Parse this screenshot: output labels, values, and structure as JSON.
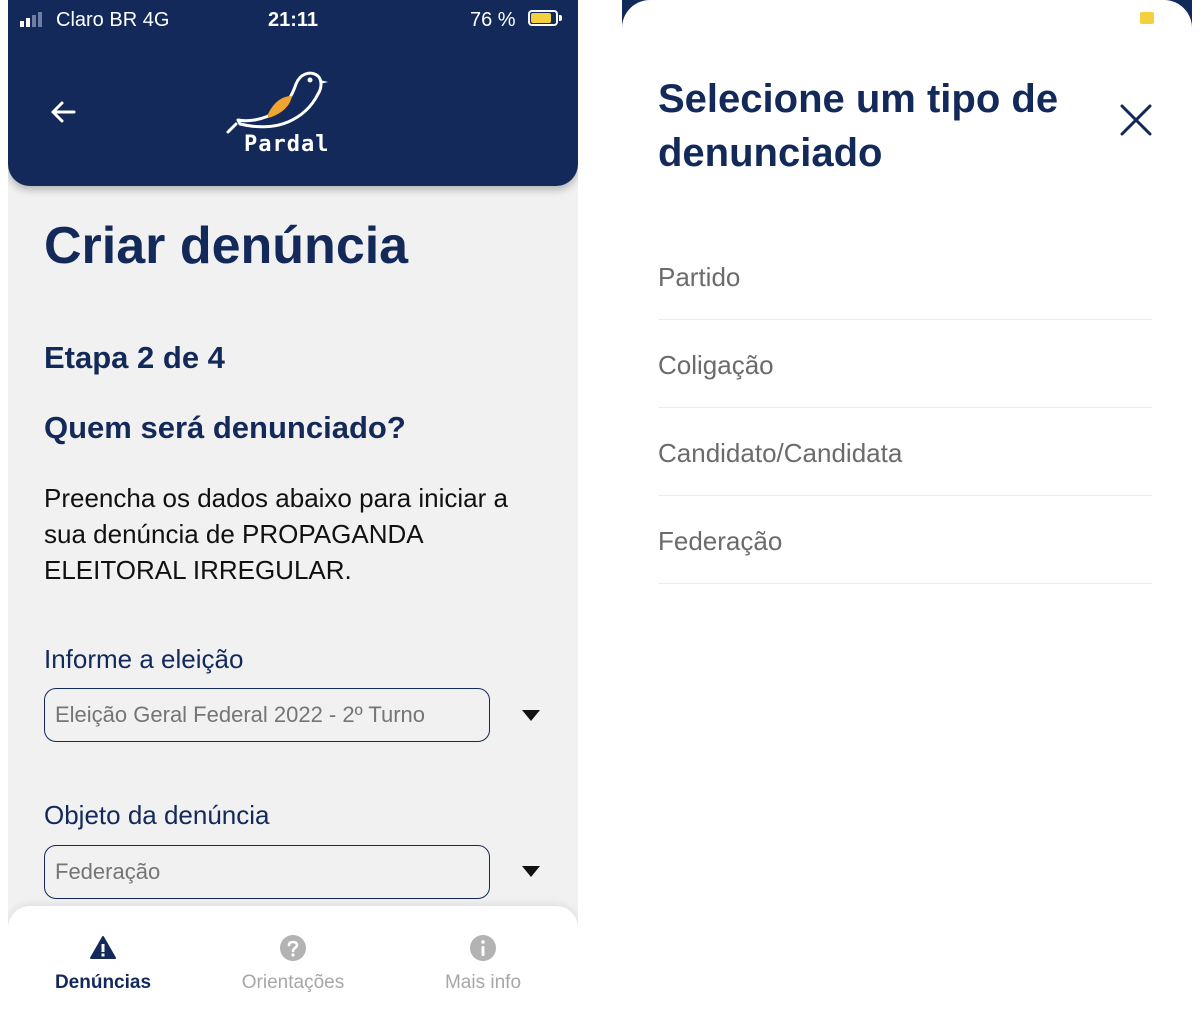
{
  "status_bar": {
    "carrier": "Claro BR  4G",
    "time": "21:11",
    "battery": "76 %"
  },
  "header": {
    "logo_text": "Pardal",
    "logo_icon": "sparrow-bird-icon",
    "back_icon": "arrow-left-icon"
  },
  "page": {
    "title": "Criar denúncia",
    "step": "Etapa 2 de 4",
    "question": "Quem será denunciado?",
    "instructions": "Preencha os dados abaixo para iniciar a sua denúncia de PROPAGANDA ELEITORAL IRREGULAR."
  },
  "form": {
    "election": {
      "label": "Informe a eleição",
      "value": "Eleição Geral Federal 2022 - 2º Turno"
    },
    "object": {
      "label": "Objeto da denúncia",
      "value": "Federação"
    }
  },
  "bottom_nav": {
    "items": [
      {
        "label": "Denúncias",
        "icon": "warning-triangle-icon",
        "active": true
      },
      {
        "label": "Orientações",
        "icon": "question-circle-icon",
        "active": false
      },
      {
        "label": "Mais info",
        "icon": "info-circle-icon",
        "active": false
      }
    ]
  },
  "modal": {
    "title": "Selecione um tipo de denunciado",
    "close_icon": "close-icon",
    "options": [
      {
        "label": "Partido"
      },
      {
        "label": "Coligação"
      },
      {
        "label": "Candidato/Candidata"
      },
      {
        "label": "Federação"
      }
    ]
  },
  "colors": {
    "primary": "#13295a",
    "background": "#f1f1f1",
    "muted_text": "#6b6b6b",
    "battery": "#f4d03f"
  }
}
